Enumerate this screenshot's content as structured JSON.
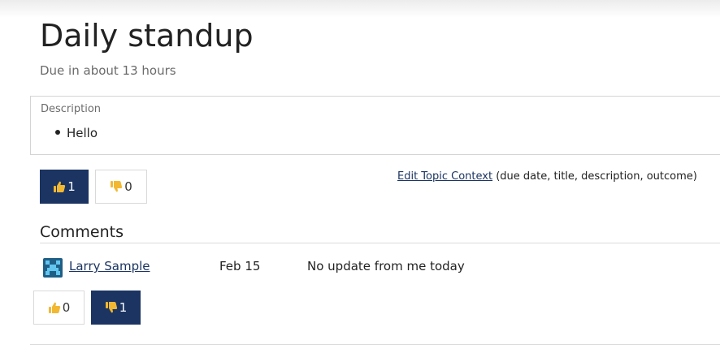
{
  "topic": {
    "title": "Daily standup",
    "due": "Due in about 13 hours"
  },
  "description": {
    "label": "Description",
    "items": [
      "Hello"
    ]
  },
  "topic_votes": {
    "up": {
      "count": "1",
      "icon": "thumbs-up-icon",
      "active": true
    },
    "down": {
      "count": "0",
      "icon": "thumbs-down-icon",
      "active": false
    }
  },
  "edit_context": {
    "link_label": "Edit Topic Context",
    "note": "(due date, title, description, outcome)"
  },
  "comments": {
    "heading": "Comments",
    "items": [
      {
        "author": "Larry Sample",
        "date": "Feb 15",
        "text": "No update from me today",
        "votes": {
          "up": {
            "count": "0",
            "active": false
          },
          "down": {
            "count": "1",
            "active": true
          }
        }
      }
    ]
  },
  "colors": {
    "accent": "#1b3462",
    "thumb": "#f2b832",
    "avatar_bg": "#1f5f86",
    "avatar_fg": "#62c6ef"
  }
}
